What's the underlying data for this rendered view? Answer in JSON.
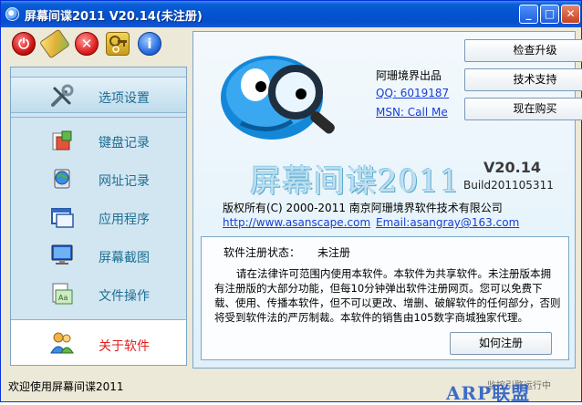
{
  "window": {
    "title": "屏幕间谍2011 V20.14(未注册)",
    "min_glyph": "_",
    "max_glyph": "□",
    "close_glyph": "✕"
  },
  "toolbar": {
    "power_glyph": "⏻",
    "close_glyph": "✕",
    "info_glyph": "i"
  },
  "nav": {
    "items": [
      {
        "label": "选项设置"
      },
      {
        "label": "键盘记录"
      },
      {
        "label": "网址记录"
      },
      {
        "label": "应用程序"
      },
      {
        "label": "屏幕截图"
      },
      {
        "label": "文件操作"
      },
      {
        "label": "关于软件"
      }
    ]
  },
  "about": {
    "buttons": {
      "check_update": "检查升级",
      "support": "技术支持",
      "buy_now": "现在购买"
    },
    "producer": "阿珊境界出品",
    "qq_link": "QQ: 6019187",
    "msn_link": "MSN: Call Me",
    "product_title": "屏幕间谍2011",
    "version": "V20.14",
    "build": "Build201105311",
    "copyright": "版权所有(C) 2000-2011  南京阿珊境界软件技术有限公司",
    "website": "http://www.asanscape.com",
    "email": "Email:asangray@163.com"
  },
  "registration": {
    "status_label": "软件注册状态：",
    "status_value": "未注册",
    "notice": "请在法律许可范围内使用本软件。本软件为共享软件。未注册版本拥有注册版的大部分功能，但每10分钟弹出软件注册网页。您可以免费下载、使用、传播本软件，但不可以更改、增删、破解软件的任何部分，否则将受到软件法的严厉制裁。本软件的销售由105数字商城独家代理。",
    "how_button": "如何注册"
  },
  "statusbar": {
    "text": "欢迎使用屏幕间谍2011",
    "watermark": "ARP联盟",
    "watermark_small": "监控引擎运行中"
  }
}
